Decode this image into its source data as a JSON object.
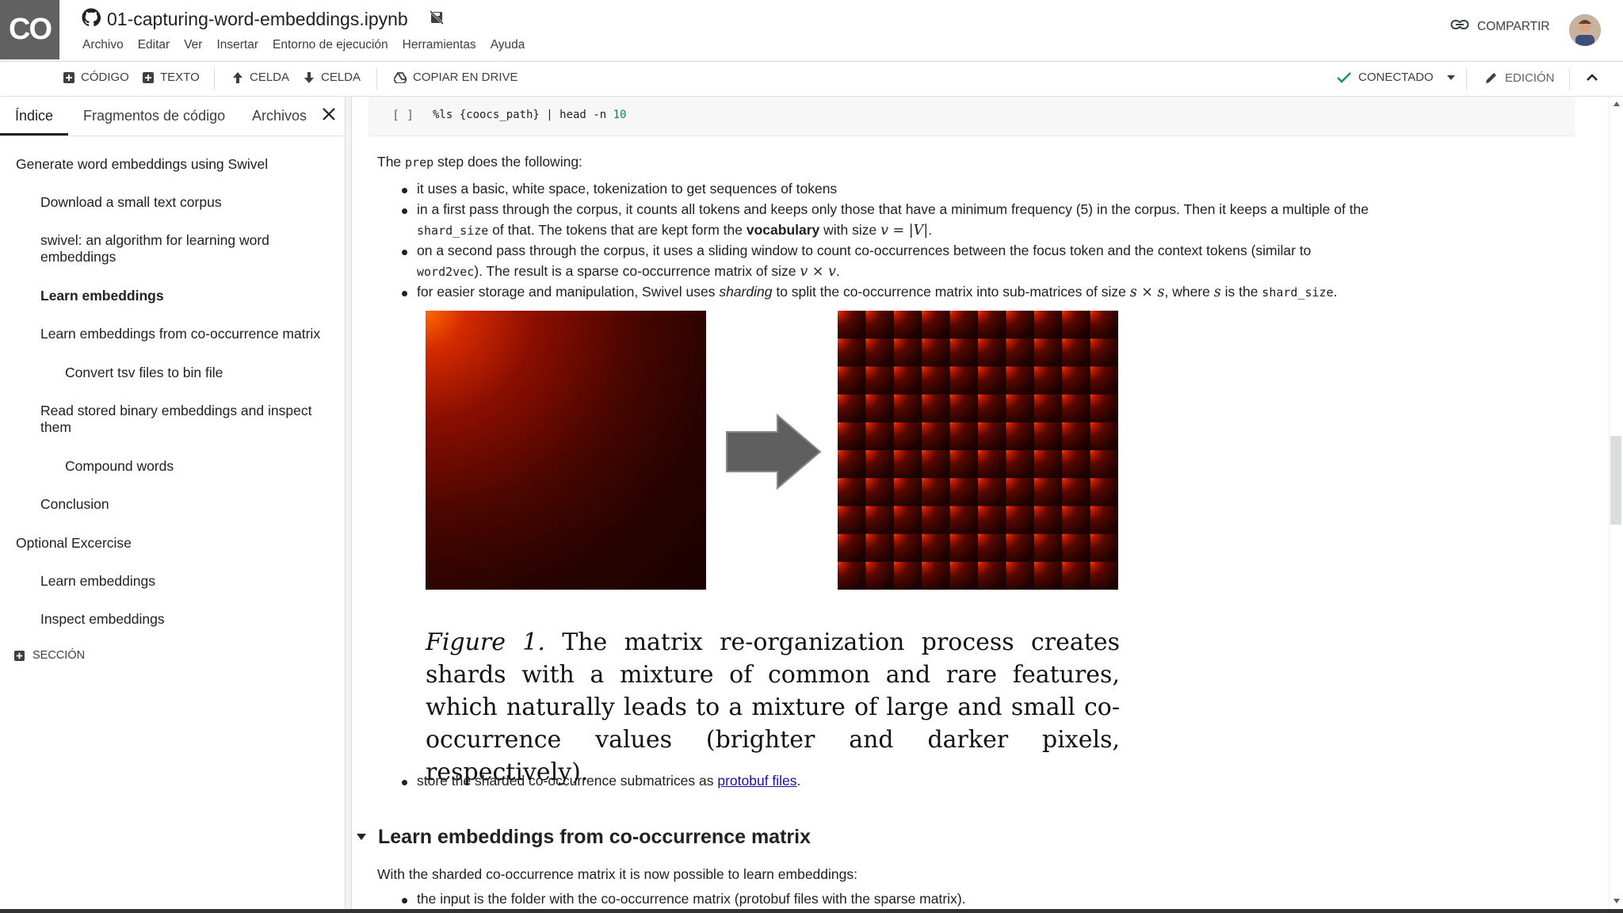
{
  "header": {
    "logo_text": "CO",
    "notebook_title": "01-capturing-word-embeddings.ipynb",
    "menu": [
      "Archivo",
      "Editar",
      "Ver",
      "Insertar",
      "Entorno de ejecución",
      "Herramientas",
      "Ayuda"
    ],
    "share_label": "COMPARTIR"
  },
  "toolbar": {
    "code_label": "CÓDIGO",
    "text_label": "TEXTO",
    "cell_up_label": "CELDA",
    "cell_down_label": "CELDA",
    "drive_label": "COPIAR EN DRIVE",
    "connected_label": "CONECTADO",
    "edit_label": "EDICIÓN",
    "connected_color": "#0f9d58"
  },
  "sidebar": {
    "tabs": [
      "Índice",
      "Fragmentos de código",
      "Archivos"
    ],
    "toc": [
      {
        "label": "Generate word embeddings using Swivel",
        "level": 1,
        "bold": false
      },
      {
        "label": "Download a small text corpus",
        "level": 2,
        "bold": false
      },
      {
        "label": "swivel: an algorithm for learning word embeddings",
        "level": 2,
        "bold": false
      },
      {
        "label": "Learn embeddings",
        "level": 2,
        "bold": true
      },
      {
        "label": "Learn embeddings from co-occurrence matrix",
        "level": 2,
        "bold": false
      },
      {
        "label": "Convert tsv files to bin file",
        "level": 3,
        "bold": false
      },
      {
        "label": "Read stored binary embeddings and inspect them",
        "level": 2,
        "bold": false
      },
      {
        "label": "Compound words",
        "level": 3,
        "bold": false
      },
      {
        "label": "Conclusion",
        "level": 2,
        "bold": false
      },
      {
        "label": "Optional Excercise",
        "level": 1,
        "bold": false
      },
      {
        "label": "Learn embeddings",
        "level": 2,
        "bold": false
      },
      {
        "label": "Inspect embeddings",
        "level": 2,
        "bold": false
      }
    ],
    "section_button": "SECCIÓN"
  },
  "cell": {
    "run_bracket": "[ ]",
    "code_prefix": "%ls {coocs_path} | head -n ",
    "code_number": "10"
  },
  "content": {
    "intro_before": "The ",
    "intro_code": "prep",
    "intro_after": " step does the following:",
    "b1": "it uses a basic, white space, tokenization to get sequences of tokens",
    "b2_line1": "in a first pass through the corpus, it counts all tokens and keeps only those that have a minimum frequency (5) in the corpus. Then it keeps a multiple of the",
    "b2_code": "shard_size",
    "b2_mid": " of that. The tokens that are kept form the ",
    "b2_bold": "vocabulary",
    "b2_after": " with size ",
    "b2_math": "v = |V|",
    "b2_end": ".",
    "b3_line1": "on a second pass through the corpus, it uses a sliding window to count co-occurrences between the focus token and the context tokens (similar to",
    "b3_code": "word2vec",
    "b3_after": "). The result is a sparse co-occurrence matrix of size ",
    "b3_math": "v × v",
    "b3_end": ".",
    "b4_before": "for easier storage and manipulation, Swivel uses ",
    "b4_italic": "sharding",
    "b4_mid": " to split the co-occurrence matrix into sub-matrices of size ",
    "b4_math1": "s × s",
    "b4_mid2": ", where ",
    "b4_math2": "s",
    "b4_mid3": " is the ",
    "b4_code": "shard_size",
    "b4_end": ".",
    "figure_label": "Figure 1.",
    "figure_caption": " The matrix re-organization process creates shards with a mixture of common and rare features, which naturally leads to a mixture of large and small co-occurrence values (brighter and darker pixels, respectively).",
    "b5_before": "store the sharded co-occurrence submatrices as ",
    "b5_link": "protobuf files",
    "b5_end": ".",
    "section_title": "Learn embeddings from co-occurrence matrix",
    "section_intro": "With the sharded co-occurrence matrix it is now possible to learn embeddings:",
    "b6": "the input is the folder with the co-occurrence matrix (protobuf files with the sparse matrix)."
  }
}
